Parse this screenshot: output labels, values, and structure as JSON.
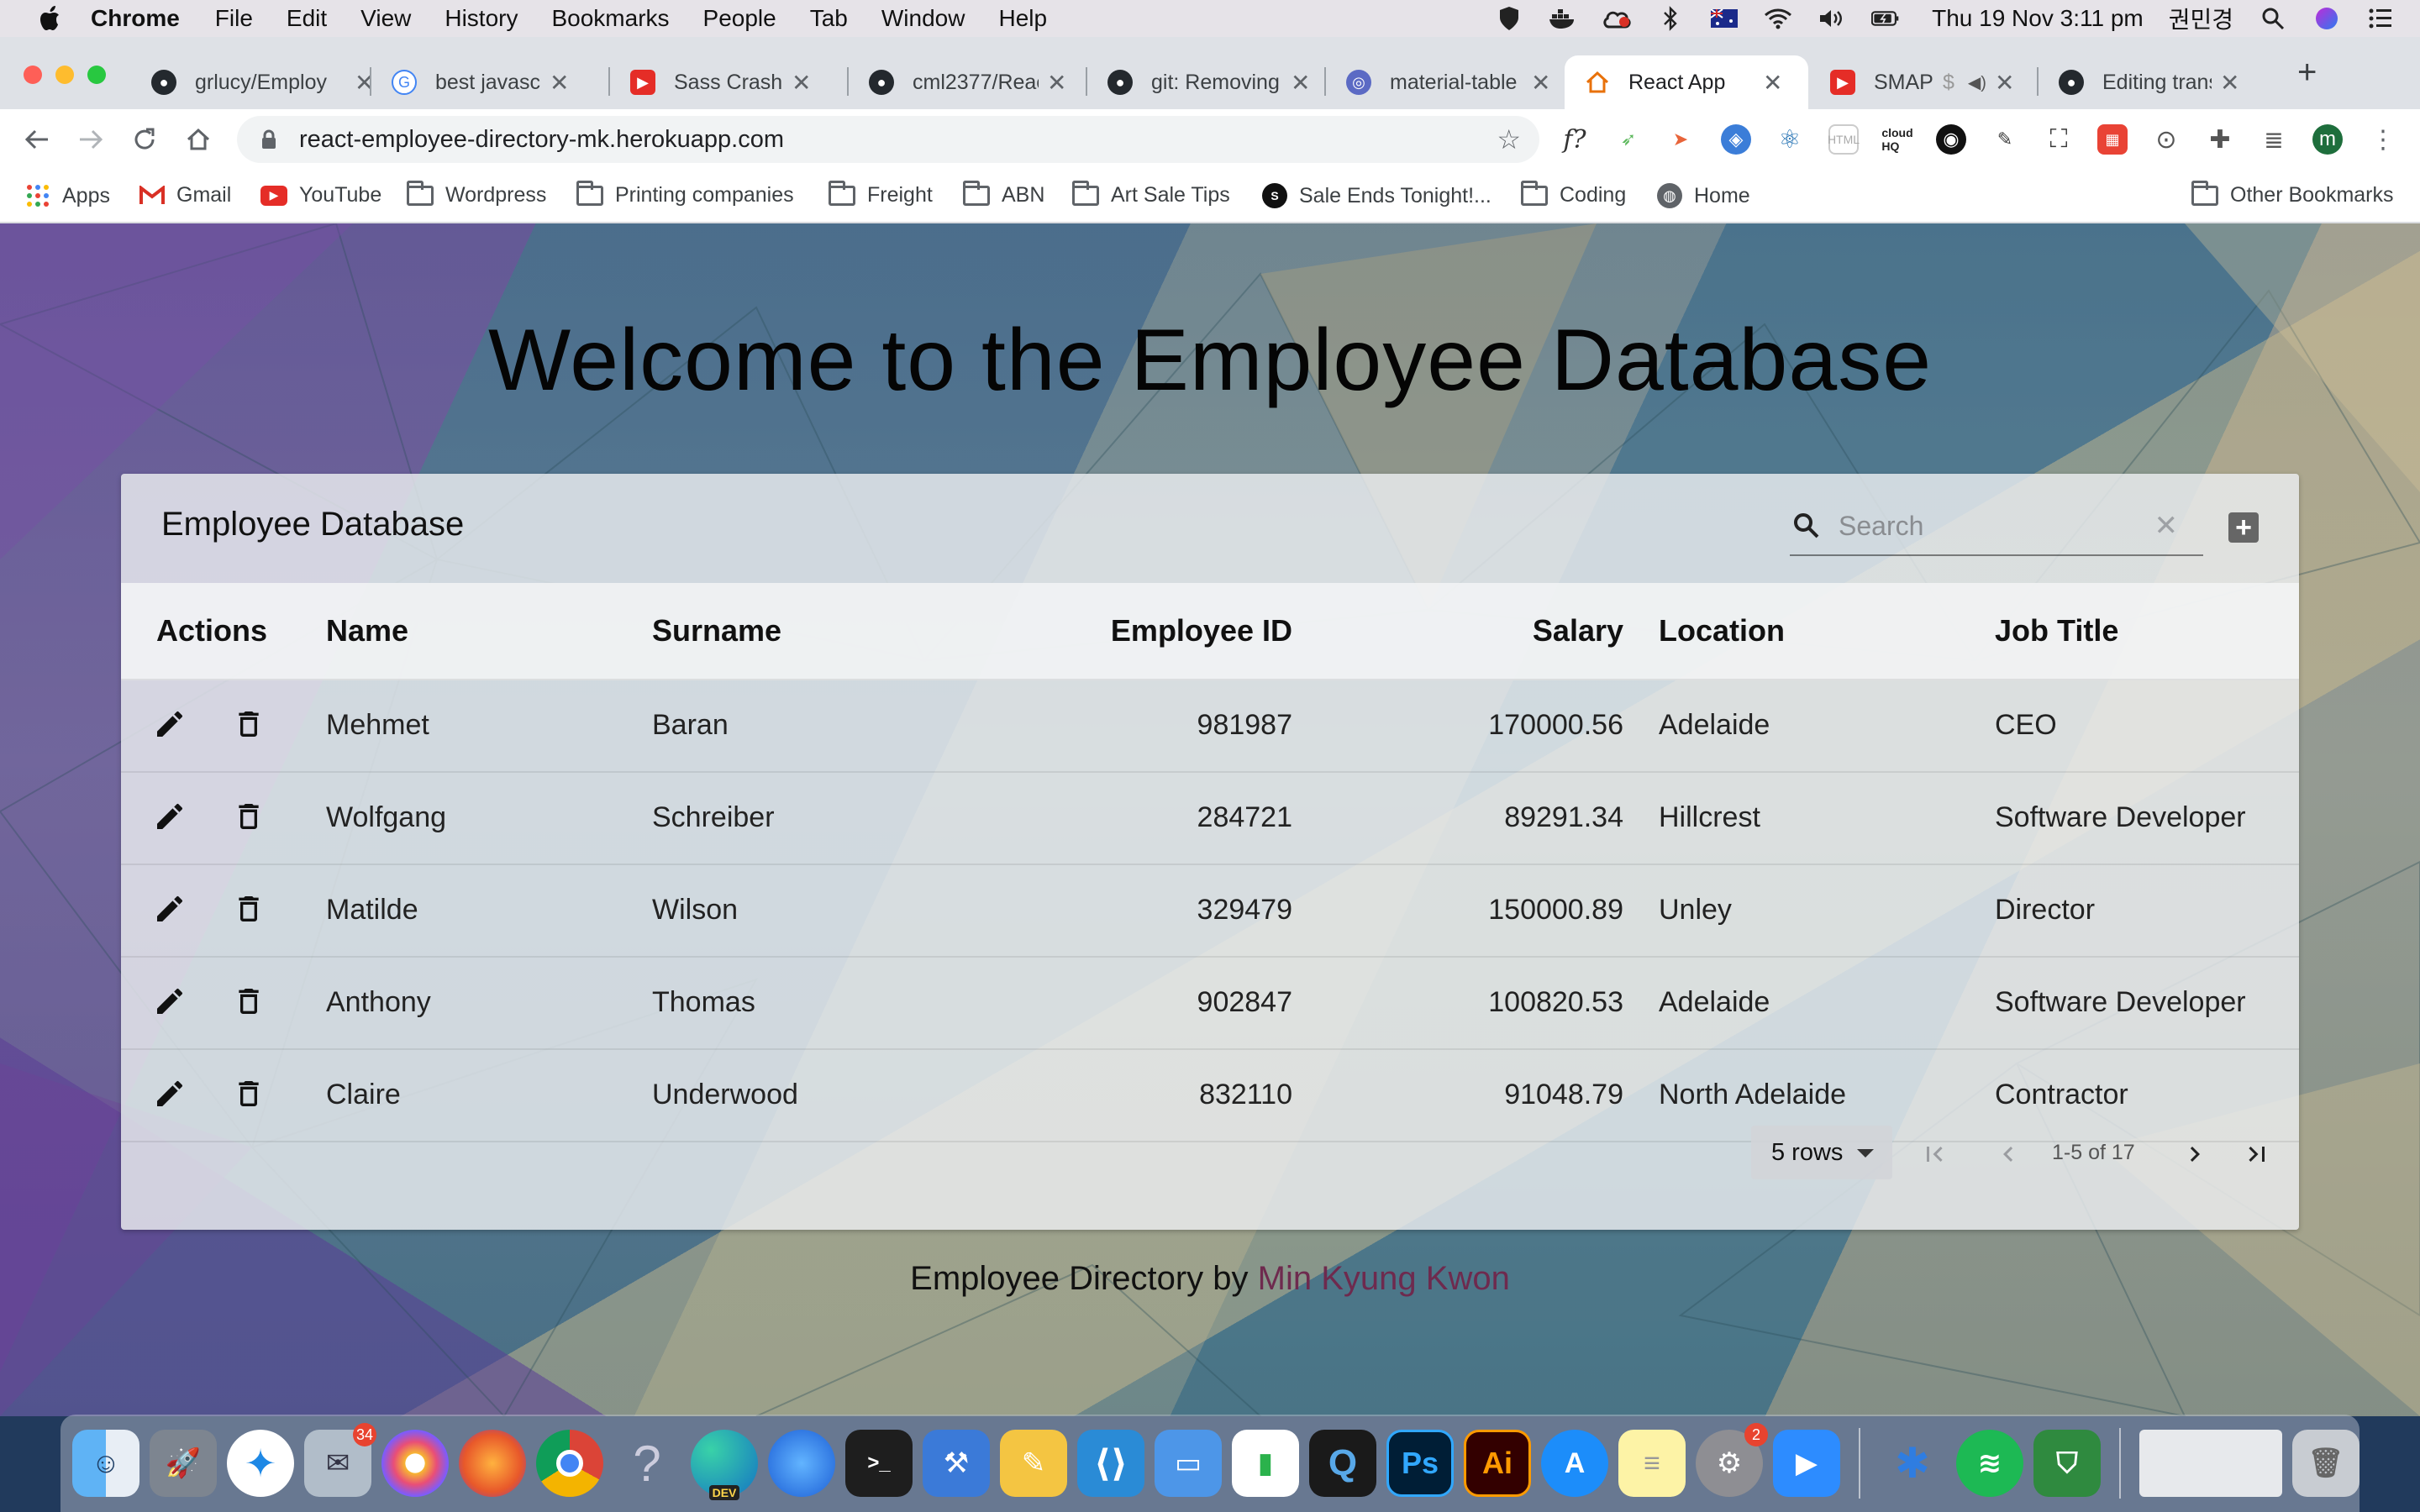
{
  "menubar": {
    "app_name": "Chrome",
    "items": [
      "File",
      "Edit",
      "View",
      "History",
      "Bookmarks",
      "People",
      "Tab",
      "Window",
      "Help"
    ],
    "clock": "Thu 19 Nov  3:11 pm",
    "user": "권민경"
  },
  "tabs": [
    {
      "title": "grlucy/Employ",
      "icon": "github-icon"
    },
    {
      "title": "best javascrip",
      "icon": "google-icon"
    },
    {
      "title": "Sass Crash C",
      "icon": "youtube-icon"
    },
    {
      "title": "cml2377/Reac",
      "icon": "github-icon"
    },
    {
      "title": "git: Removing",
      "icon": "github-icon"
    },
    {
      "title": "material-table",
      "icon": "globe-icon"
    },
    {
      "title": "React App",
      "icon": "home-icon",
      "active": true
    },
    {
      "title": "SMAP",
      "icon": "youtube-icon"
    },
    {
      "title": "Editing transa",
      "icon": "github-icon"
    }
  ],
  "toolbar": {
    "url": "react-employee-directory-mk.herokuapp.com",
    "profile_initial": "m"
  },
  "bookmarks": [
    {
      "label": "Apps",
      "icon": "apps-grid-icon"
    },
    {
      "label": "Gmail",
      "icon": "gmail-icon"
    },
    {
      "label": "YouTube",
      "icon": "youtube-icon"
    },
    {
      "label": "Wordpress",
      "icon": "folder-icon"
    },
    {
      "label": "Printing companies",
      "icon": "folder-icon"
    },
    {
      "label": "Freight",
      "icon": "folder-icon"
    },
    {
      "label": "ABN",
      "icon": "folder-icon"
    },
    {
      "label": "Art Sale Tips",
      "icon": "folder-icon"
    },
    {
      "label": "Sale Ends Tonight!...",
      "icon": "sale-icon"
    },
    {
      "label": "Coding",
      "icon": "folder-icon"
    },
    {
      "label": "Home",
      "icon": "globe-icon"
    }
  ],
  "other_bookmarks": "Other Bookmarks",
  "page": {
    "heading": "Welcome to the Employee Database",
    "table_title": "Employee Database",
    "search_placeholder": "Search",
    "columns": [
      "Actions",
      "Name",
      "Surname",
      "Employee ID",
      "Salary",
      "Location",
      "Job Title"
    ],
    "rows": [
      {
        "name": "Mehmet",
        "surname": "Baran",
        "id": "981987",
        "salary": "170000.56",
        "location": "Adelaide",
        "job": "CEO"
      },
      {
        "name": "Wolfgang",
        "surname": "Schreiber",
        "id": "284721",
        "salary": "89291.34",
        "location": "Hillcrest",
        "job": "Software Developer"
      },
      {
        "name": "Matilde",
        "surname": "Wilson",
        "id": "329479",
        "salary": "150000.89",
        "location": "Unley",
        "job": "Director"
      },
      {
        "name": "Anthony",
        "surname": "Thomas",
        "id": "902847",
        "salary": "100820.53",
        "location": "Adelaide",
        "job": "Software Developer"
      },
      {
        "name": "Claire",
        "surname": "Underwood",
        "id": "832110",
        "salary": "91048.79",
        "location": "North Adelaide",
        "job": "Contractor"
      }
    ],
    "pagination": {
      "rows_per_page": "5 rows",
      "range": "1-5 of 17"
    },
    "footer_prefix": "Employee Directory by",
    "footer_author": "Min Kyung Kwon"
  },
  "dock_badges": {
    "mail": "34",
    "system_prefs": "2"
  }
}
